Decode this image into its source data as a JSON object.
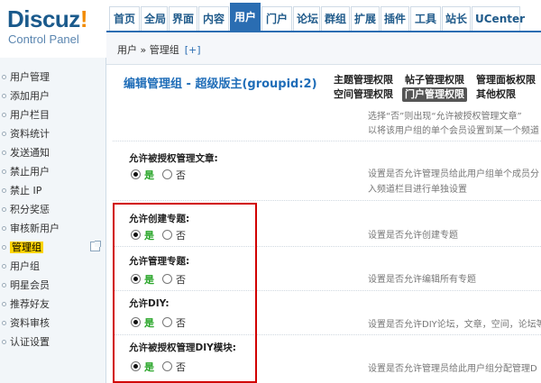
{
  "logo": {
    "brand": "Discuz",
    "bang": "!",
    "subtitle": "Control Panel"
  },
  "topnav": [
    {
      "label": "首页",
      "active": false
    },
    {
      "label": "全局",
      "active": false
    },
    {
      "label": "界面",
      "active": false
    },
    {
      "label": "内容",
      "active": false
    },
    {
      "label": "用户",
      "active": true
    },
    {
      "label": "门户",
      "active": false
    },
    {
      "label": "论坛",
      "active": false
    },
    {
      "label": "群组",
      "active": false
    },
    {
      "label": "扩展",
      "active": false
    },
    {
      "label": "插件",
      "active": false
    },
    {
      "label": "工具",
      "active": false
    },
    {
      "label": "站长",
      "active": false
    },
    {
      "label": "UCenter",
      "active": false
    }
  ],
  "breadcrumb": {
    "text": "用户 » 管理组",
    "plus": "[+]"
  },
  "sidebar": {
    "items": [
      {
        "label": "用户管理"
      },
      {
        "label": "添加用户"
      },
      {
        "label": "用户栏目"
      },
      {
        "label": "资料统计"
      },
      {
        "label": "发送通知"
      },
      {
        "label": "禁止用户"
      },
      {
        "label": "禁止 IP"
      },
      {
        "label": "积分奖惩"
      },
      {
        "label": "审核新用户"
      },
      {
        "label": "管理组",
        "active": true
      },
      {
        "label": "用户组"
      },
      {
        "label": "明星会员"
      },
      {
        "label": "推荐好友"
      },
      {
        "label": "资料审核"
      },
      {
        "label": "认证设置"
      }
    ]
  },
  "main": {
    "title": "编辑管理组 - 超级版主(groupid:2)",
    "tabs": [
      {
        "label": "主题管理权限",
        "active": false
      },
      {
        "label": "帖子管理权限",
        "active": false
      },
      {
        "label": "管理面板权限",
        "active": false
      },
      {
        "label": "空间管理权限",
        "active": false
      },
      {
        "label": "门户管理权限",
        "active": true
      },
      {
        "label": "其他权限",
        "active": false
      }
    ],
    "top_desc_1": "选择“否”则出现“允许被授权管理文章”",
    "top_desc_2": "以将该用户组的单个会员设置到某一个频道",
    "yes": "是",
    "no": "否",
    "settings": [
      {
        "label": "允许被授权管理文章:",
        "value": "yes",
        "desc_1": "设置是否允许管理员给此用户组单个成员分",
        "desc_2": "入频道栏目进行单独设置"
      },
      {
        "label": "允许创建专题:",
        "value": "yes",
        "desc_1": "设置是否允许创建专题",
        "desc_2": ""
      },
      {
        "label": "允许管理专题:",
        "value": "yes",
        "desc_1": "设置是否允许编辑所有专题",
        "desc_2": ""
      },
      {
        "label": "允许DIY:",
        "value": "yes",
        "desc_1": "设置是否允许DIY论坛，文章，空间，论坛等",
        "desc_2": ""
      },
      {
        "label": "允许被授权管理DIY模块:",
        "value": "yes",
        "desc_1": "设置是否允许管理员给此用户组分配管理D",
        "desc_2": ""
      }
    ]
  },
  "colors": {
    "accent": "#2a6db2",
    "highlight": "#ffd400",
    "annotation": "#d10000",
    "yes_green": "#2aa62a"
  }
}
